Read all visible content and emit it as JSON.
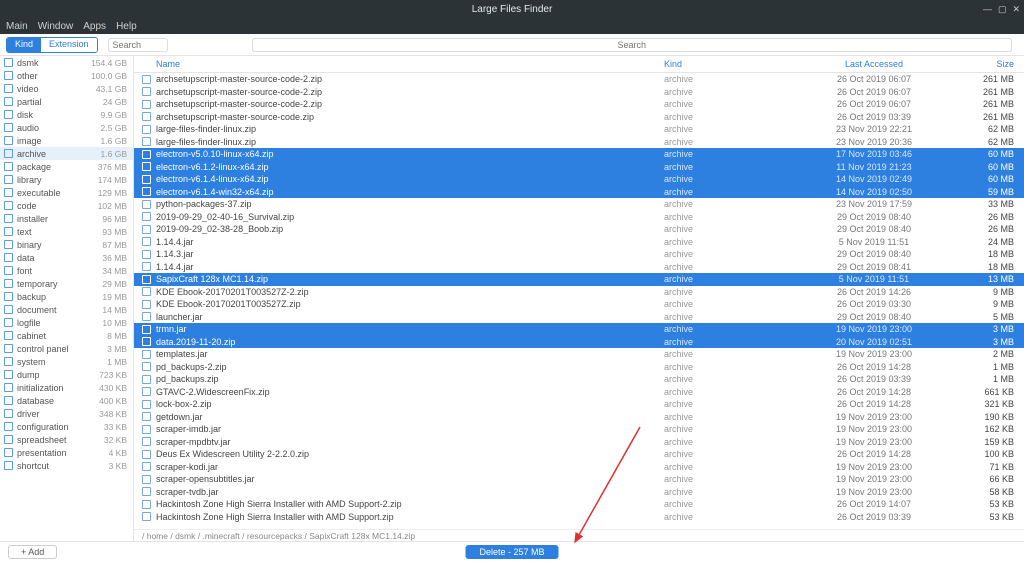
{
  "window": {
    "title": "Large Files Finder"
  },
  "menus": [
    "Main",
    "Window",
    "Apps",
    "Help"
  ],
  "toolbar": {
    "tabs": [
      {
        "label": "Kind",
        "active": true
      },
      {
        "label": "Extension",
        "active": false
      }
    ],
    "sidebar_search_placeholder": "Search",
    "main_search_placeholder": "Search"
  },
  "columns": {
    "name": "Name",
    "kind": "Kind",
    "date": "Last Accessed",
    "size": "Size"
  },
  "sidebar": [
    {
      "label": "dsmk",
      "size": "154.4 GB"
    },
    {
      "label": "other",
      "size": "100.0 GB"
    },
    {
      "label": "video",
      "size": "43.1 GB"
    },
    {
      "label": "partial",
      "size": "24 GB"
    },
    {
      "label": "disk",
      "size": "9.9 GB"
    },
    {
      "label": "audio",
      "size": "2.5 GB"
    },
    {
      "label": "image",
      "size": "1.6 GB"
    },
    {
      "label": "archive",
      "size": "1.6 GB",
      "selected": true
    },
    {
      "label": "package",
      "size": "376 MB"
    },
    {
      "label": "library",
      "size": "174 MB"
    },
    {
      "label": "executable",
      "size": "129 MB"
    },
    {
      "label": "code",
      "size": "102 MB"
    },
    {
      "label": "installer",
      "size": "96 MB"
    },
    {
      "label": "text",
      "size": "93 MB"
    },
    {
      "label": "binary",
      "size": "87 MB"
    },
    {
      "label": "data",
      "size": "36 MB"
    },
    {
      "label": "font",
      "size": "34 MB"
    },
    {
      "label": "temporary",
      "size": "29 MB"
    },
    {
      "label": "backup",
      "size": "19 MB"
    },
    {
      "label": "document",
      "size": "14 MB"
    },
    {
      "label": "logfile",
      "size": "10 MB"
    },
    {
      "label": "cabinet",
      "size": "8 MB"
    },
    {
      "label": "control panel",
      "size": "3 MB"
    },
    {
      "label": "system",
      "size": "1 MB"
    },
    {
      "label": "dump",
      "size": "723 KB"
    },
    {
      "label": "initialization",
      "size": "430 KB"
    },
    {
      "label": "database",
      "size": "400 KB"
    },
    {
      "label": "driver",
      "size": "348 KB"
    },
    {
      "label": "configuration",
      "size": "33 KB"
    },
    {
      "label": "spreadsheet",
      "size": "32 KB"
    },
    {
      "label": "presentation",
      "size": "4 KB"
    },
    {
      "label": "shortcut",
      "size": "3 KB"
    }
  ],
  "files": [
    {
      "name": "archsetupscript-master-source-code-2.zip",
      "kind": "archive",
      "date": "26 Oct 2019 06:07",
      "size": "261 MB"
    },
    {
      "name": "archsetupscript-master-source-code-2.zip",
      "kind": "archive",
      "date": "26 Oct 2019 06:07",
      "size": "261 MB"
    },
    {
      "name": "archsetupscript-master-source-code-2.zip",
      "kind": "archive",
      "date": "26 Oct 2019 06:07",
      "size": "261 MB"
    },
    {
      "name": "archsetupscript-master-source-code.zip",
      "kind": "archive",
      "date": "26 Oct 2019 03:39",
      "size": "261 MB"
    },
    {
      "name": "large-files-finder-linux.zip",
      "kind": "archive",
      "date": "23 Nov 2019 22:21",
      "size": "62 MB"
    },
    {
      "name": "large-files-finder-linux.zip",
      "kind": "archive",
      "date": "23 Nov 2019 20:36",
      "size": "62 MB"
    },
    {
      "name": "electron-v5.0.10-linux-x64.zip",
      "kind": "archive",
      "date": "17 Nov 2019 03:46",
      "size": "60 MB",
      "selected": true
    },
    {
      "name": "electron-v6.1.2-linux-x64.zip",
      "kind": "archive",
      "date": "11 Nov 2019 21:23",
      "size": "60 MB",
      "selected": true
    },
    {
      "name": "electron-v6.1.4-linux-x64.zip",
      "kind": "archive",
      "date": "14 Nov 2019 02:49",
      "size": "60 MB",
      "selected": true
    },
    {
      "name": "electron-v6.1.4-win32-x64.zip",
      "kind": "archive",
      "date": "14 Nov 2019 02:50",
      "size": "59 MB",
      "selected": true
    },
    {
      "name": "python-packages-37.zip",
      "kind": "archive",
      "date": "23 Nov 2019 17:59",
      "size": "33 MB"
    },
    {
      "name": "2019-09-29_02-40-16_Survival.zip",
      "kind": "archive",
      "date": "29 Oct 2019 08:40",
      "size": "26 MB"
    },
    {
      "name": "2019-09-29_02-38-28_Boob.zip",
      "kind": "archive",
      "date": "29 Oct 2019 08:40",
      "size": "26 MB"
    },
    {
      "name": "1.14.4.jar",
      "kind": "archive",
      "date": "5 Nov 2019 11:51",
      "size": "24 MB"
    },
    {
      "name": "1.14.3.jar",
      "kind": "archive",
      "date": "29 Oct 2019 08:40",
      "size": "18 MB"
    },
    {
      "name": "1.14.4.jar",
      "kind": "archive",
      "date": "29 Oct 2019 08:41",
      "size": "18 MB"
    },
    {
      "name": "SapixCraft 128x MC1.14.zip",
      "kind": "archive",
      "date": "5 Nov 2019 11:51",
      "size": "13 MB",
      "selected": true
    },
    {
      "name": "KDE Ebook-20170201T003527Z-2.zip",
      "kind": "archive",
      "date": "26 Oct 2019 14:26",
      "size": "9 MB"
    },
    {
      "name": "KDE Ebook-20170201T003527Z.zip",
      "kind": "archive",
      "date": "26 Oct 2019 03:30",
      "size": "9 MB"
    },
    {
      "name": "launcher.jar",
      "kind": "archive",
      "date": "29 Oct 2019 08:40",
      "size": "5 MB"
    },
    {
      "name": "trmn.jar",
      "kind": "archive",
      "date": "19 Nov 2019 23:00",
      "size": "3 MB",
      "selected": true
    },
    {
      "name": "data.2019-11-20.zip",
      "kind": "archive",
      "date": "20 Nov 2019 02:51",
      "size": "3 MB",
      "selected": true
    },
    {
      "name": "templates.jar",
      "kind": "archive",
      "date": "19 Nov 2019 23:00",
      "size": "2 MB"
    },
    {
      "name": "pd_backups-2.zip",
      "kind": "archive",
      "date": "26 Oct 2019 14:28",
      "size": "1 MB"
    },
    {
      "name": "pd_backups.zip",
      "kind": "archive",
      "date": "26 Oct 2019 03:39",
      "size": "1 MB"
    },
    {
      "name": "GTAVC-2.WidescreenFix.zip",
      "kind": "archive",
      "date": "26 Oct 2019 14:28",
      "size": "661 KB"
    },
    {
      "name": "lock-box-2.zip",
      "kind": "archive",
      "date": "26 Oct 2019 14:28",
      "size": "321 KB"
    },
    {
      "name": "getdown.jar",
      "kind": "archive",
      "date": "19 Nov 2019 23:00",
      "size": "190 KB"
    },
    {
      "name": "scraper-imdb.jar",
      "kind": "archive",
      "date": "19 Nov 2019 23:00",
      "size": "162 KB"
    },
    {
      "name": "scraper-mpdbtv.jar",
      "kind": "archive",
      "date": "19 Nov 2019 23:00",
      "size": "159 KB"
    },
    {
      "name": "Deus Ex Widescreen Utility 2-2.2.0.zip",
      "kind": "archive",
      "date": "26 Oct 2019 14:28",
      "size": "100 KB"
    },
    {
      "name": "scraper-kodi.jar",
      "kind": "archive",
      "date": "19 Nov 2019 23:00",
      "size": "71 KB"
    },
    {
      "name": "scraper-opensubtitles.jar",
      "kind": "archive",
      "date": "19 Nov 2019 23:00",
      "size": "66 KB"
    },
    {
      "name": "scraper-tvdb.jar",
      "kind": "archive",
      "date": "19 Nov 2019 23:00",
      "size": "58 KB"
    },
    {
      "name": "Hackintosh Zone High Sierra Installer with AMD Support-2.zip",
      "kind": "archive",
      "date": "26 Oct 2019 14:07",
      "size": "53 KB"
    },
    {
      "name": "Hackintosh Zone High Sierra Installer with AMD Support.zip",
      "kind": "archive",
      "date": "26 Oct 2019 03:39",
      "size": "53 KB"
    }
  ],
  "breadcrumb": "/ home / dsmk / .minecraft / resourcepacks / SapixCraft 128x MC1.14.zip",
  "footer": {
    "add": "+  Add",
    "delete": "Delete - 257 MB"
  }
}
